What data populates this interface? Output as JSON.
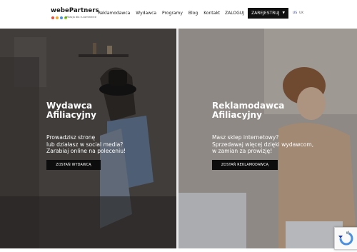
{
  "header": {
    "logo": {
      "name": "webePartners",
      "tagline": "afiliacja dla e-commerce"
    },
    "nav": [
      {
        "label": "Reklamodawca"
      },
      {
        "label": "Wydawca"
      },
      {
        "label": "Programy"
      },
      {
        "label": "Blog"
      },
      {
        "label": "Kontakt"
      }
    ],
    "login_label": "ZALOGUJ",
    "register_label": "ZAREJESTRUJ",
    "languages": [
      "US",
      "UK"
    ]
  },
  "hero_left": {
    "title_line1": "Wydawca",
    "title_line2": "Afiliacyjny",
    "text_line1": "Prowadzisz stronę",
    "text_line2": "lub działasz w social media?",
    "text_line3": "Zarabiaj online na poleceniu!",
    "button_label": "ZOSTAŃ WYDAWCĄ"
  },
  "hero_right": {
    "title_line1": "Reklamodawca",
    "title_line2": "Afiliacyjny",
    "text_line1": "Masz sklep internetowy?",
    "text_line2": "Sprzedawaj więcej dzięki wydawcom,",
    "text_line3": "w zamian za prowizję!",
    "button_label": "ZOSTAŃ REKLAMODAWCĄ"
  },
  "colors": {
    "header_bg": "#ffffff",
    "cta_bg": "#0d0d0d",
    "logo_dots": [
      "#e94b3c",
      "#f5a623",
      "#4a90e2",
      "#7ed321"
    ]
  },
  "icons": {
    "register_dropdown": "caret-down-icon",
    "recaptcha": "recaptcha-icon"
  }
}
